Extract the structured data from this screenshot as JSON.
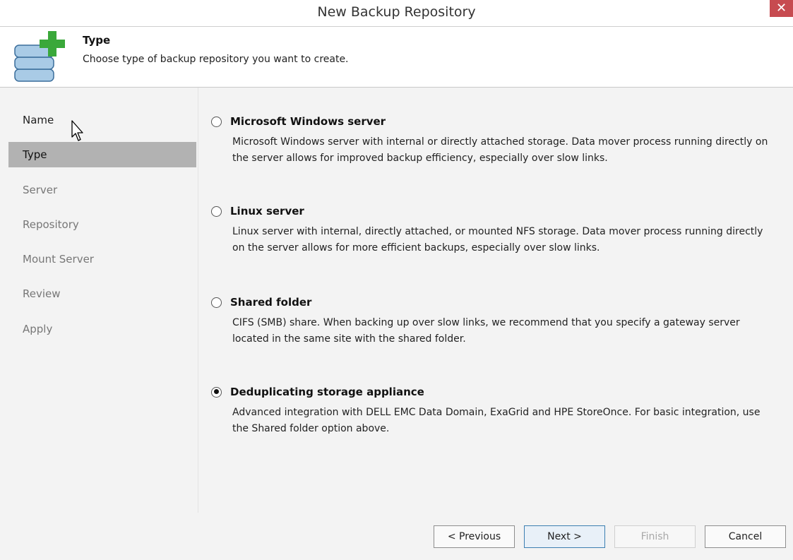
{
  "window": {
    "title": "New Backup Repository",
    "close_glyph": "✕"
  },
  "header": {
    "title": "Type",
    "description": "Choose type of backup repository you want to create.",
    "icon": "database-add-icon"
  },
  "nav": {
    "items": [
      {
        "label": "Name",
        "state": "done"
      },
      {
        "label": "Type",
        "state": "active"
      },
      {
        "label": "Server",
        "state": "pending"
      },
      {
        "label": "Repository",
        "state": "pending"
      },
      {
        "label": "Mount Server",
        "state": "pending"
      },
      {
        "label": "Review",
        "state": "pending"
      },
      {
        "label": "Apply",
        "state": "pending"
      }
    ]
  },
  "options": [
    {
      "label": "Microsoft Windows server",
      "description": "Microsoft Windows server with internal or directly attached storage. Data mover process running directly on the server allows for improved backup efficiency, especially over slow links.",
      "selected": false
    },
    {
      "label": "Linux server",
      "description": "Linux server with internal, directly attached, or mounted NFS storage. Data mover process running directly on the server allows for more efficient backups, especially over slow links.",
      "selected": false
    },
    {
      "label": "Shared folder",
      "description": "CIFS (SMB) share. When backing up over slow links, we recommend that you specify a gateway server located in the same site with the shared folder.",
      "selected": false
    },
    {
      "label": "Deduplicating storage appliance",
      "description": "Advanced integration with DELL EMC Data Domain, ExaGrid and HPE StoreOnce. For basic integration, use the Shared folder option above.",
      "selected": true
    }
  ],
  "footer": {
    "previous": "< Previous",
    "next": "Next >",
    "finish": "Finish",
    "cancel": "Cancel"
  },
  "colors": {
    "nav_active_bg": "#b2b2b2",
    "panel_bg": "#f3f3f3",
    "close_bg": "#c74b50",
    "icon_plus": "#3aa83a",
    "icon_db": "#a9cbe6"
  }
}
